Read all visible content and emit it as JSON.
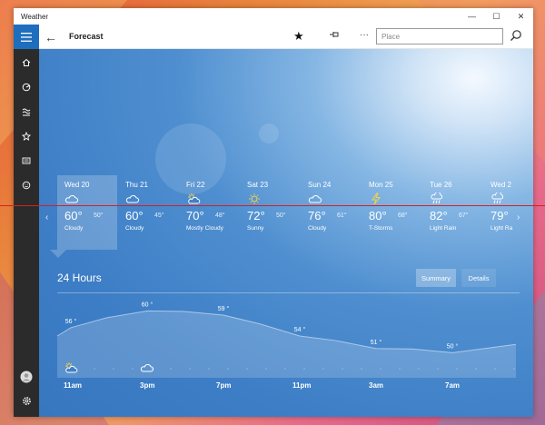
{
  "window": {
    "title": "Weather"
  },
  "appbar": {
    "title": "Forecast",
    "search_placeholder": "Place"
  },
  "days": [
    {
      "name": "Wed 20",
      "hi": "60°",
      "lo": "50°",
      "condition": "Cloudy",
      "icon": "cloud-icon"
    },
    {
      "name": "Thu 21",
      "hi": "60°",
      "lo": "45°",
      "condition": "Cloudy",
      "icon": "cloud-icon"
    },
    {
      "name": "Fri 22",
      "hi": "70°",
      "lo": "48°",
      "condition": "Mostly Cloudy",
      "icon": "partly-cloudy-icon"
    },
    {
      "name": "Sat 23",
      "hi": "72°",
      "lo": "50°",
      "condition": "Sunny",
      "icon": "sun-icon"
    },
    {
      "name": "Sun 24",
      "hi": "76°",
      "lo": "61°",
      "condition": "Cloudy",
      "icon": "cloud-icon"
    },
    {
      "name": "Mon 25",
      "hi": "80°",
      "lo": "68°",
      "condition": "T-Storms",
      "icon": "lightning-icon"
    },
    {
      "name": "Tue 26",
      "hi": "82°",
      "lo": "67°",
      "condition": "Light Rain",
      "icon": "rain-icon"
    },
    {
      "name": "Wed 2",
      "hi": "79°",
      "lo": "",
      "condition": "Light Ra",
      "icon": "rain-icon"
    }
  ],
  "hours": {
    "title": "24 Hours",
    "tabs": [
      "Summary",
      "Details"
    ],
    "temps": [
      {
        "label": "56 °",
        "value": 56
      },
      {
        "label": "60 °",
        "value": 60
      },
      {
        "label": "59 °",
        "value": 59
      },
      {
        "label": "54 °",
        "value": 54
      },
      {
        "label": "51 °",
        "value": 51
      },
      {
        "label": "50 °",
        "value": 50
      }
    ],
    "times": [
      "11am",
      "3pm",
      "7pm",
      "11pm",
      "3am",
      "7am"
    ]
  },
  "colors": {
    "accent": "#1e6ebd",
    "sidebar": "#2b2b2b"
  }
}
